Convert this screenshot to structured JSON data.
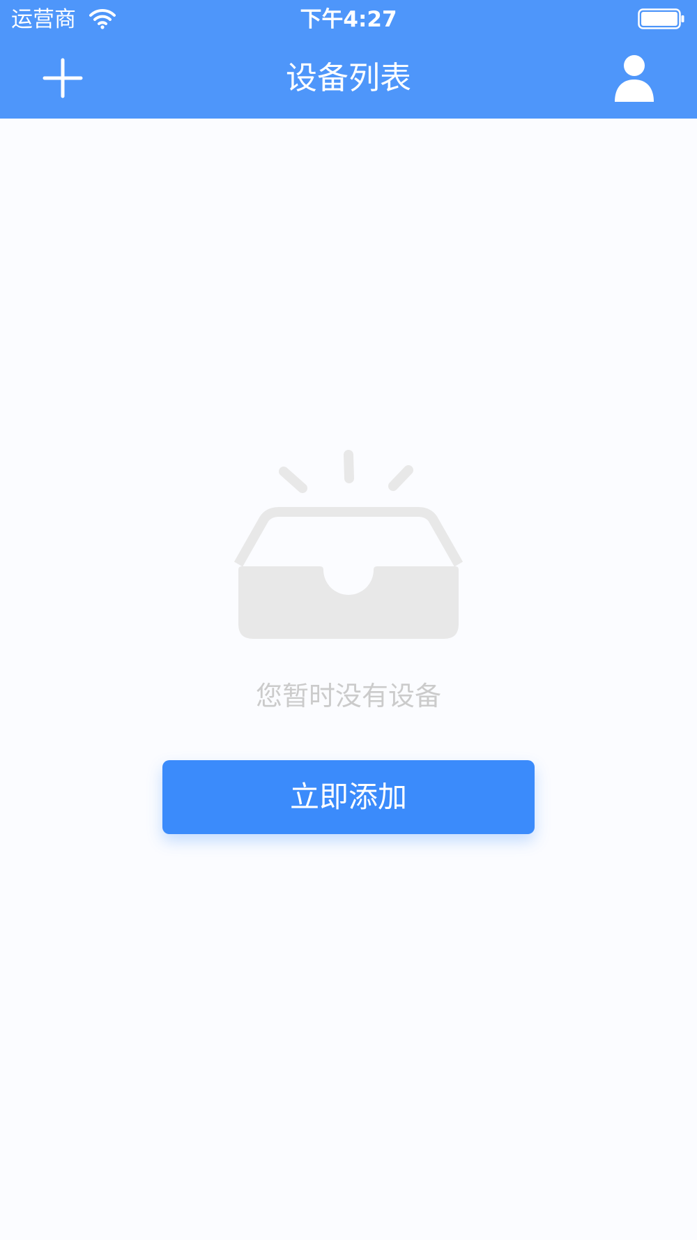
{
  "status_bar": {
    "carrier": "运营商",
    "time": "下午4:27",
    "wifi_icon": "wifi-icon",
    "battery_icon": "battery-icon"
  },
  "navbar": {
    "title": "设备列表",
    "left_icon": "plus-icon",
    "right_icon": "user-icon"
  },
  "empty_state": {
    "icon": "empty-inbox-icon",
    "message": "您暂时没有设备",
    "action_label": "立即添加"
  },
  "colors": {
    "header_background": "#4E96FA",
    "button_background": "#3B8BFB",
    "page_background": "#FBFCFF",
    "empty_icon": "#E8E8E8",
    "empty_text": "#CBCBCB"
  }
}
